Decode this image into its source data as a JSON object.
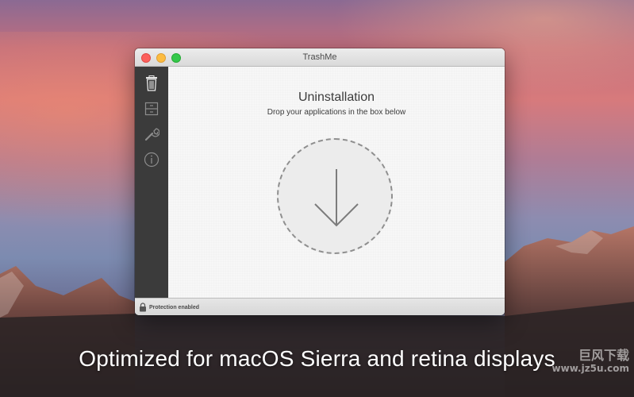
{
  "window": {
    "title": "TrashMe"
  },
  "sidebar": {
    "items": [
      {
        "icon": "trash-icon"
      },
      {
        "icon": "cabinet-icon"
      },
      {
        "icon": "wrench-icon"
      },
      {
        "icon": "info-icon"
      }
    ]
  },
  "main": {
    "heading": "Uninstallation",
    "subheading": "Drop your applications in the box below",
    "dropzone_icon": "arrow-down-icon"
  },
  "statusbar": {
    "text": "Protection enabled",
    "icon": "lock-icon"
  },
  "promo": {
    "caption": "Optimized for macOS Sierra and retina displays"
  },
  "watermark": {
    "line1": "巨风下载",
    "line2": "www.jz5u.com"
  },
  "colors": {
    "traffic_close": "#fc605c",
    "traffic_minimize": "#fdbc40",
    "traffic_maximize": "#34c84a",
    "sidebar_bg": "#3b3b3b"
  }
}
